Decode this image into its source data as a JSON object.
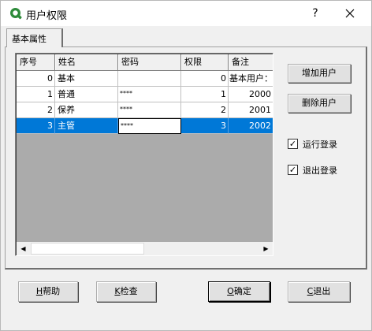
{
  "window": {
    "title": "用户权限",
    "help_glyph": "?",
    "close_glyph": "✕"
  },
  "tabs": [
    {
      "label": "基本属性"
    }
  ],
  "grid": {
    "columns": [
      "序号",
      "姓名",
      "密码",
      "权限",
      "备注"
    ],
    "rows": [
      {
        "id": "0",
        "name": "基本",
        "password": "",
        "level": "0",
        "note": "基本用户："
      },
      {
        "id": "1",
        "name": "普通",
        "password": "****",
        "level": "1",
        "note": "2000"
      },
      {
        "id": "2",
        "name": "保养",
        "password": "****",
        "level": "2",
        "note": "2001"
      },
      {
        "id": "3",
        "name": "主管",
        "password": "****",
        "level": "3",
        "note": "2002"
      }
    ],
    "selected_row": 3,
    "scroll_left_glyph": "◀",
    "scroll_right_glyph": "▶"
  },
  "side_buttons": {
    "add_user": "增加用户",
    "delete_user": "删除用户"
  },
  "options": {
    "run_login": {
      "label": "运行登录",
      "checked": true,
      "mark": "✓"
    },
    "exit_login": {
      "label": "退出登录",
      "checked": true,
      "mark": "✓"
    }
  },
  "footer_buttons": {
    "help": {
      "mnemonic": "H",
      "label": "帮助"
    },
    "check": {
      "mnemonic": "K",
      "label": "检查"
    },
    "ok": {
      "mnemonic": "O",
      "label": "确定"
    },
    "cancel": {
      "mnemonic": "C",
      "label": "退出"
    }
  }
}
